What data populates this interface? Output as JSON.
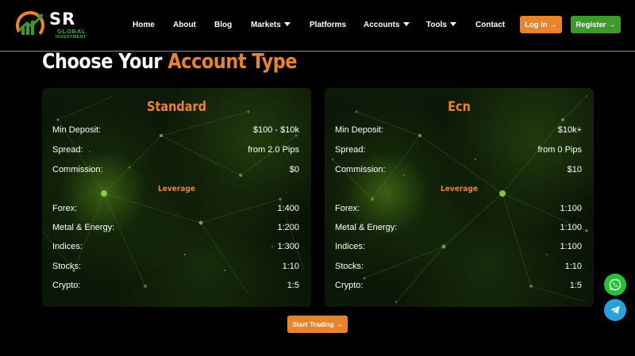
{
  "brand": {
    "mark": "SR",
    "line1": "GLOBAL",
    "line2": "INVESTMENT"
  },
  "nav": {
    "home": "Home",
    "about": "About",
    "blog": "Blog",
    "markets": "Markets",
    "platforms": "Platforms",
    "accounts": "Accounts",
    "tools": "Tools",
    "contact": "Contact",
    "login": "Log in →",
    "register": "Register →"
  },
  "page": {
    "title_plain": "Choose Your",
    "title_accent": "Account Type",
    "cta": "Start Trading →"
  },
  "cards": [
    {
      "title": "Standard",
      "rows": [
        {
          "label": "Min Deposit:",
          "value": "$100 - $10k"
        },
        {
          "label": "Spread:",
          "value": "from 2.0 Pips"
        },
        {
          "label": "Commission:",
          "value": "$0"
        }
      ],
      "leverage_title": "Leverage",
      "leverage": [
        {
          "label": "Forex:",
          "value": "1:400"
        },
        {
          "label": "Metal & Energy:",
          "value": "1:200"
        },
        {
          "label": "Indices:",
          "value": "1:300"
        },
        {
          "label": "Stocks:",
          "value": "1:10"
        },
        {
          "label": "Crypto:",
          "value": "1:5"
        }
      ]
    },
    {
      "title": "Ecn",
      "rows": [
        {
          "label": "Min Deposit:",
          "value": "$10k+"
        },
        {
          "label": "Spread:",
          "value": "from 0 Pips"
        },
        {
          "label": "Commission:",
          "value": "$10"
        }
      ],
      "leverage_title": "Leverage",
      "leverage": [
        {
          "label": "Forex:",
          "value": "1:100"
        },
        {
          "label": "Metal & Energy:",
          "value": "1:100"
        },
        {
          "label": "Indices:",
          "value": "1:100"
        },
        {
          "label": "Stocks:",
          "value": "1:10"
        },
        {
          "label": "Crypto:",
          "value": "1:5"
        }
      ]
    }
  ],
  "icons": {
    "whatsapp": "whatsapp-icon",
    "telegram": "telegram-icon"
  },
  "colors": {
    "accent": "#e8842c",
    "brand_green": "#3e9a2c",
    "whatsapp": "#25c236",
    "telegram": "#2aa0da"
  }
}
